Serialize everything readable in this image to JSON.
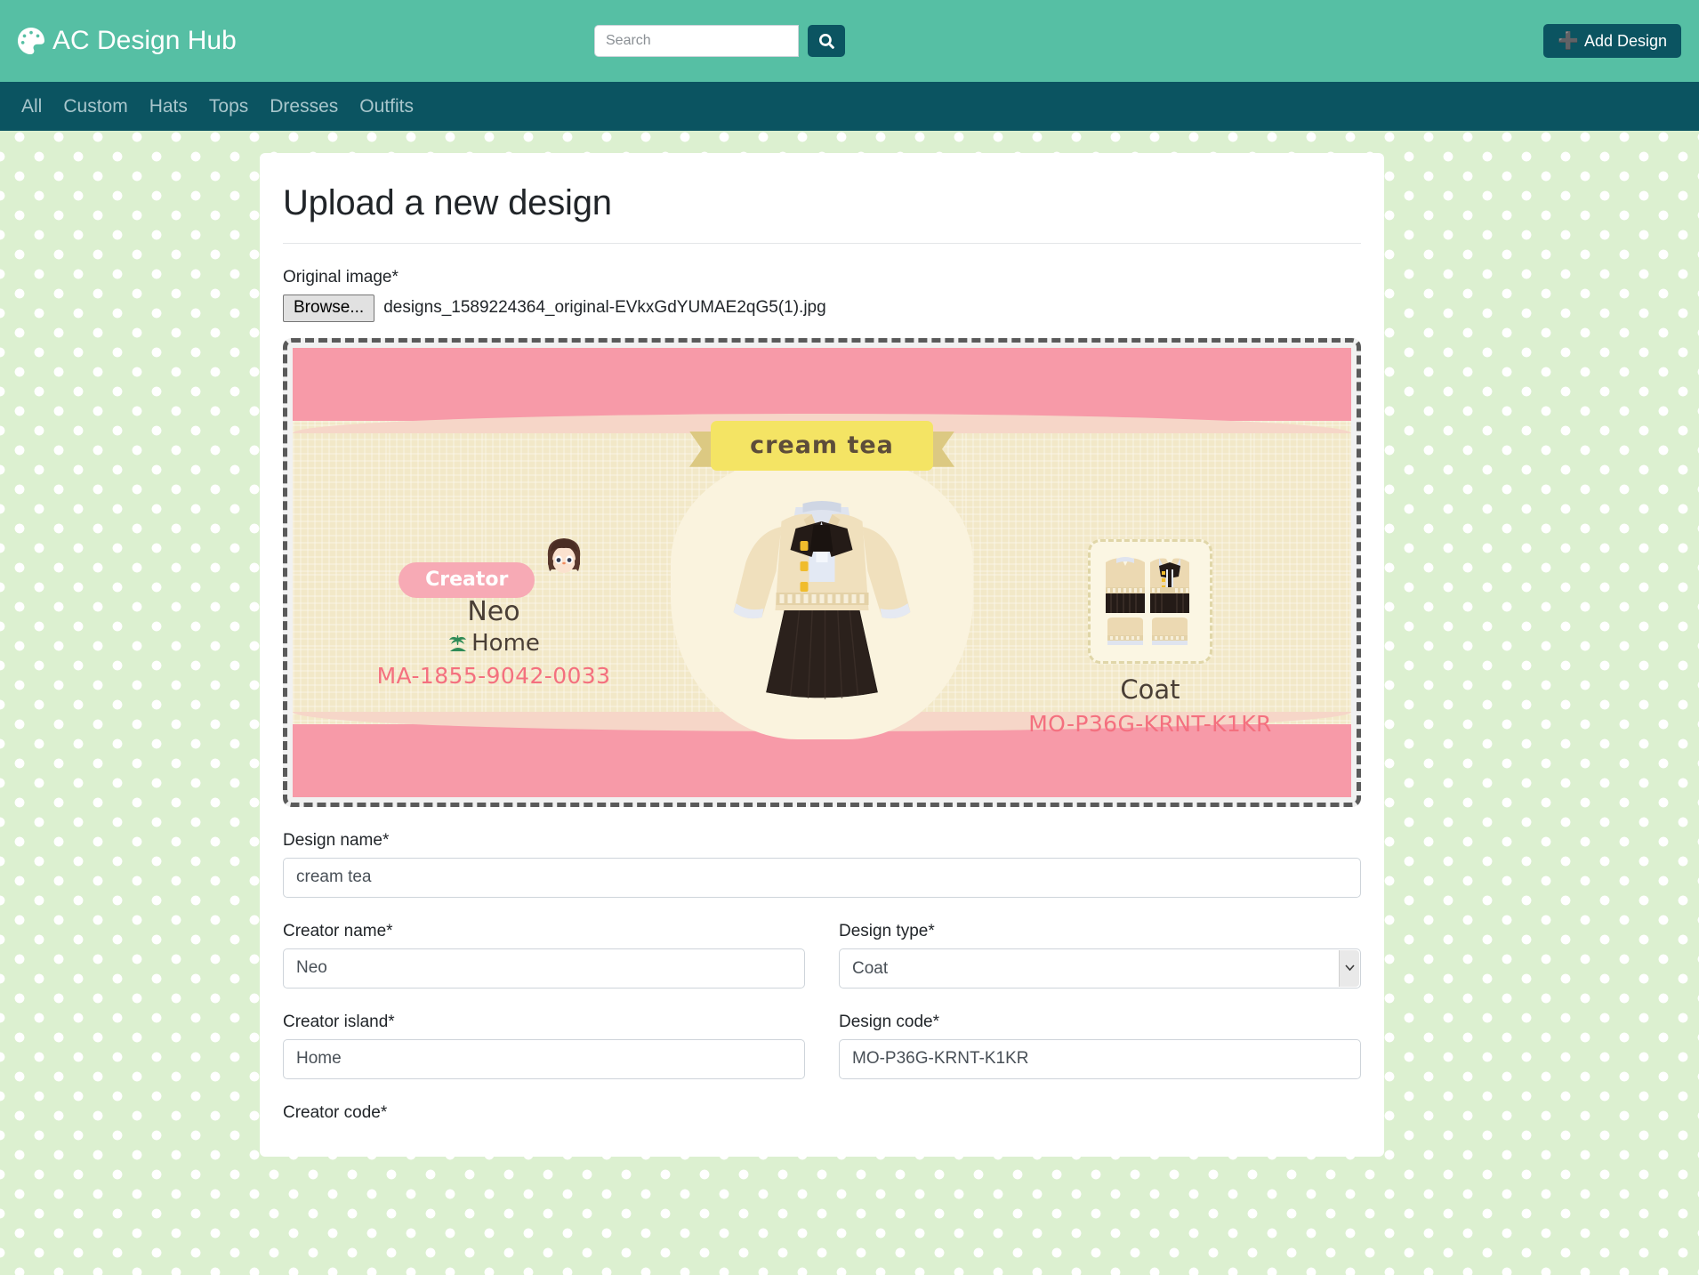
{
  "header": {
    "brand": "AC Design Hub",
    "brand_icon": "palette-icon",
    "search": {
      "placeholder": "Search",
      "value": "",
      "button_icon": "search-icon"
    },
    "add_design_label": "Add Design",
    "add_design_icon": "plus-icon",
    "bg_color": "#56bfa4",
    "accent_dark": "#0b5461"
  },
  "nav": {
    "items": [
      {
        "label": "All"
      },
      {
        "label": "Custom"
      },
      {
        "label": "Hats"
      },
      {
        "label": "Tops"
      },
      {
        "label": "Dresses"
      },
      {
        "label": "Outfits"
      }
    ]
  },
  "form": {
    "title": "Upload a new design",
    "original_image_label": "Original image*",
    "browse_button": "Browse...",
    "file_name": "designs_1589224364_original-EVkxGdYUMAE2qG5(1).jpg",
    "design_name_label": "Design name*",
    "design_name_value": "cream tea",
    "creator_name_label": "Creator name*",
    "creator_name_value": "Neo",
    "design_type_label": "Design type*",
    "design_type_value": "Coat",
    "design_type_options": [
      "Coat"
    ],
    "creator_island_label": "Creator island*",
    "creator_island_value": "Home",
    "design_code_label": "Design code*",
    "design_code_value": "MO-P36G-KRNT-K1KR",
    "creator_code_label": "Creator code*"
  },
  "preview": {
    "banner_text": "cream tea",
    "creator_pill": "Creator",
    "creator_name": "Neo",
    "creator_island": "Home",
    "creator_code": "MA-1855-9042-0033",
    "design_type": "Coat",
    "design_code": "MO-P36G-KRNT-K1KR",
    "colors": {
      "band": "#f79aa8",
      "body": "#f2e8c8",
      "banner": "#f4e464",
      "pill": "#f7aab5",
      "code_text": "#f4707f"
    }
  },
  "page": {
    "background_color": "#dcf0d0",
    "dot_color": "#ffffff"
  }
}
